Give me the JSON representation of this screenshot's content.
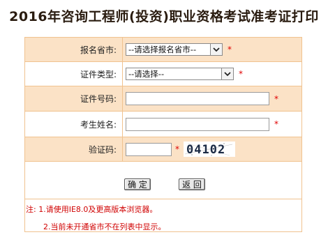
{
  "page": {
    "title": "2016年咨询工程师(投资)职业资格考试准考证打印"
  },
  "form": {
    "city": {
      "label": "报名省市:",
      "selected": "--请选择报名省市--"
    },
    "id_type": {
      "label": "证件类型:",
      "selected": "--请选择--"
    },
    "id_number": {
      "label": "证件号码:",
      "value": ""
    },
    "name": {
      "label": "考生姓名:",
      "value": ""
    },
    "captcha": {
      "label": "验证码:",
      "value": "",
      "image_text": "04102"
    },
    "required_mark": "*"
  },
  "buttons": {
    "confirm": "确 定",
    "back": "返 回"
  },
  "notes": {
    "line1": "注: 1.请使用IE8.0及更高版本浏览器。",
    "line2": "2.当前未开通省市不在列表中显示。"
  },
  "colors": {
    "row_alt": "#fbe2c6",
    "border": "#f0c28f",
    "required": "#e00000",
    "note_text": "#d00000"
  },
  "icons": {
    "select_arrow": "chevron-down-icon"
  }
}
